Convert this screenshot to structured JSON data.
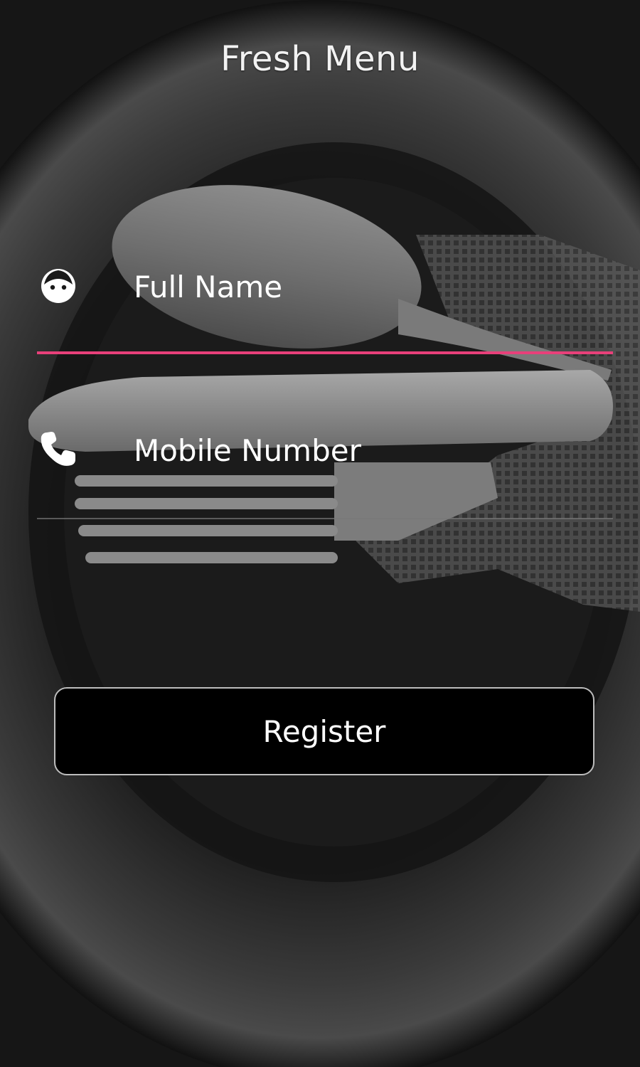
{
  "app": {
    "title": "Fresh Menu"
  },
  "form": {
    "full_name": {
      "placeholder": "Full Name",
      "value": "",
      "icon": "face-icon"
    },
    "mobile": {
      "placeholder": "Mobile Number",
      "value": "",
      "icon": "phone-icon"
    },
    "register_label": "Register"
  },
  "colors": {
    "accent": "#e8407a",
    "text": "#ffffff",
    "button_bg": "#000000",
    "button_border": "#bdbdbd"
  }
}
